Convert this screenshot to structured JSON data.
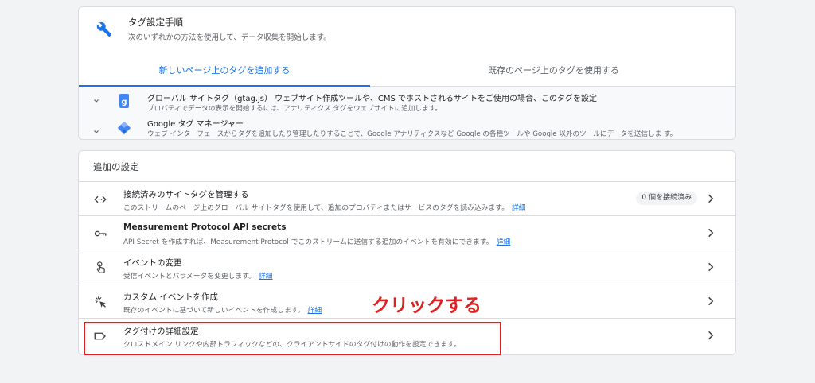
{
  "setup": {
    "icon": "wrench-icon",
    "title": "タグ設定手順",
    "subtitle": "次のいずれかの方法を使用して、データ収集を開始します。",
    "tabs": [
      {
        "label": "新しいページ上のタグを追加する"
      },
      {
        "label": "既存のページ上のタグを使用する"
      }
    ],
    "items": [
      {
        "icon": "gtag-icon",
        "title": "グローバル サイトタグ（gtag.js） ウェブサイト作成ツールや、CMS でホストされるサイトをご使用の場合、このタグを設定",
        "desc": "プロパティでデータの表示を開始するには、アナリティクス タグをウェブサイトに追加します。"
      },
      {
        "icon": "tag-manager-icon",
        "title": "Google タグ マネージャー",
        "desc": "ウェブ インターフェースからタグを追加したり管理したりすることで、Google アナリティクスなど Google の各種ツールや Google 以外のツールにデータを送信しま す。"
      }
    ]
  },
  "extra": {
    "title": "追加の設定",
    "items": [
      {
        "icon": "code-arrows-icon",
        "title": "接続済みのサイトタグを管理する",
        "desc": "このストリームのページ上のグローバル サイトタグを使用して、追加のプロパティまたはサービスのタグを読み込みます。",
        "link": "詳細",
        "badge": "0 個を接続済み"
      },
      {
        "icon": "key-icon",
        "title": "Measurement Protocol API secrets",
        "desc": "API Secret を作成すれば、Measurement Protocol でこのストリームに送信する追加のイベントを有効にできます。",
        "link": "詳細"
      },
      {
        "icon": "touch-icon",
        "title": "イベントの変更",
        "desc": "受信イベントとパラメータを変更します。",
        "link": "詳細"
      },
      {
        "icon": "sparkle-click-icon",
        "title": "カスタム イベントを作成",
        "desc": "既存のイベントに基づいて新しいイベントを作成します。",
        "link": "詳細"
      },
      {
        "icon": "label-icon",
        "title": "タグ付けの詳細設定",
        "desc": "クロスドメイン リンクや内部トラフィックなどの、クライアントサイドのタグ付けの動作を設定できます。"
      }
    ]
  },
  "annotation": "クリックする",
  "colors": {
    "accent": "#1a73e8",
    "annotation": "#e02020"
  }
}
